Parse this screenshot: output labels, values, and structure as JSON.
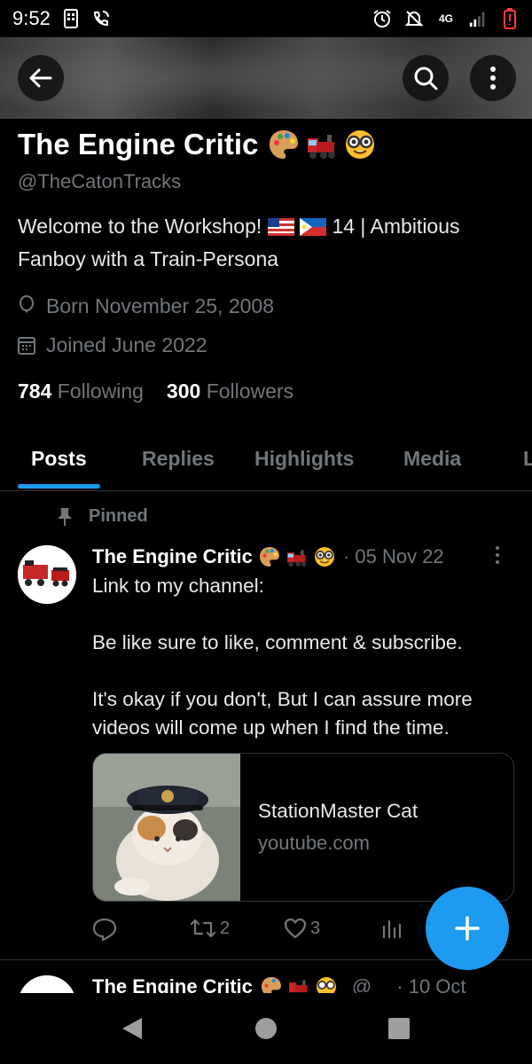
{
  "status_bar": {
    "time": "9:52",
    "network": "4G"
  },
  "profile": {
    "display_name": "The Engine Critic",
    "name_emojis": [
      "artist-palette",
      "locomotive",
      "nerd-face"
    ],
    "handle": "@TheCatonTracks",
    "bio_line1_prefix": "Welcome to the Workshop!",
    "bio_flags": [
      "us-flag",
      "philippines-flag"
    ],
    "bio_line1_suffix": "14 | Ambitious",
    "bio_line2": "Fanboy with a Train-Persona",
    "born": "Born November 25, 2008",
    "joined": "Joined June 2022",
    "following_count": "784",
    "following_label": "Following",
    "followers_count": "300",
    "followers_label": "Followers"
  },
  "tabs": [
    {
      "label": "Posts",
      "active": true
    },
    {
      "label": "Replies",
      "active": false
    },
    {
      "label": "Highlights",
      "active": false
    },
    {
      "label": "Media",
      "active": false
    },
    {
      "label": "L",
      "active": false
    }
  ],
  "pinned_post": {
    "pinned_label": "Pinned",
    "author": "The Engine Critic",
    "date": "· 05 Nov 22",
    "text": "Link to my channel:\n\nBe like sure to like, comment & subscribe.\n\nIt's okay if you don't, But I can assure more videos will come up when I find the time.",
    "card": {
      "title": "StationMaster Cat",
      "domain": "youtube.com"
    },
    "actions": {
      "replies": "",
      "reposts": "2",
      "likes": "3"
    }
  },
  "next_post": {
    "author": "The Engine Critic",
    "handle_fragment": "@",
    "date": "· 10 Oct"
  },
  "colors": {
    "accent": "#1d9bf0",
    "background": "#000000",
    "secondary_text": "#71767b"
  }
}
